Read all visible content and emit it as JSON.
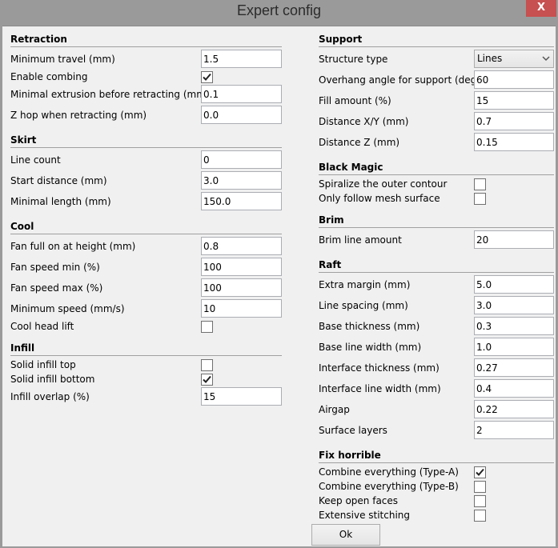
{
  "window": {
    "title": "Expert config",
    "close_label": "X"
  },
  "left": {
    "retraction": {
      "header": "Retraction",
      "minimum_travel": {
        "label": "Minimum travel (mm)",
        "value": "1.5"
      },
      "enable_combing": {
        "label": "Enable combing",
        "checked": true
      },
      "minimal_extrusion": {
        "label": "Minimal extrusion before retracting (mm)",
        "value": "0.1"
      },
      "z_hop": {
        "label": "Z hop when retracting (mm)",
        "value": "0.0"
      }
    },
    "skirt": {
      "header": "Skirt",
      "line_count": {
        "label": "Line count",
        "value": "0"
      },
      "start_distance": {
        "label": "Start distance (mm)",
        "value": "3.0"
      },
      "minimal_length": {
        "label": "Minimal length (mm)",
        "value": "150.0"
      }
    },
    "cool": {
      "header": "Cool",
      "fan_full_on": {
        "label": "Fan full on at height (mm)",
        "value": "0.8"
      },
      "fan_speed_min": {
        "label": "Fan speed min (%)",
        "value": "100"
      },
      "fan_speed_max": {
        "label": "Fan speed max (%)",
        "value": "100"
      },
      "minimum_speed": {
        "label": "Minimum speed (mm/s)",
        "value": "10"
      },
      "cool_head_lift": {
        "label": "Cool head lift",
        "checked": false
      }
    },
    "infill": {
      "header": "Infill",
      "solid_top": {
        "label": "Solid infill top",
        "checked": false
      },
      "solid_bottom": {
        "label": "Solid infill bottom",
        "checked": true
      },
      "overlap": {
        "label": "Infill overlap (%)",
        "value": "15"
      }
    }
  },
  "right": {
    "support": {
      "header": "Support",
      "structure_type": {
        "label": "Structure type",
        "value": "Lines"
      },
      "overhang_angle": {
        "label": "Overhang angle for support (deg)",
        "value": "60"
      },
      "fill_amount": {
        "label": "Fill amount (%)",
        "value": "15"
      },
      "distance_xy": {
        "label": "Distance X/Y (mm)",
        "value": "0.7"
      },
      "distance_z": {
        "label": "Distance Z (mm)",
        "value": "0.15"
      }
    },
    "black_magic": {
      "header": "Black Magic",
      "spiralize": {
        "label": "Spiralize the outer contour",
        "checked": false
      },
      "follow_surface": {
        "label": "Only follow mesh surface",
        "checked": false
      }
    },
    "brim": {
      "header": "Brim",
      "line_amount": {
        "label": "Brim line amount",
        "value": "20"
      }
    },
    "raft": {
      "header": "Raft",
      "extra_margin": {
        "label": "Extra margin (mm)",
        "value": "5.0"
      },
      "line_spacing": {
        "label": "Line spacing (mm)",
        "value": "3.0"
      },
      "base_thickness": {
        "label": "Base thickness (mm)",
        "value": "0.3"
      },
      "base_line_width": {
        "label": "Base line width (mm)",
        "value": "1.0"
      },
      "interface_thickness": {
        "label": "Interface thickness (mm)",
        "value": "0.27"
      },
      "interface_line_width": {
        "label": "Interface line width (mm)",
        "value": "0.4"
      },
      "airgap": {
        "label": "Airgap",
        "value": "0.22"
      },
      "surface_layers": {
        "label": "Surface layers",
        "value": "2"
      }
    },
    "fix_horrible": {
      "header": "Fix horrible",
      "combine_a": {
        "label": "Combine everything (Type-A)",
        "checked": true
      },
      "combine_b": {
        "label": "Combine everything (Type-B)",
        "checked": false
      },
      "keep_open_faces": {
        "label": "Keep open faces",
        "checked": false
      },
      "extensive_stitching": {
        "label": "Extensive stitching",
        "checked": false
      }
    }
  },
  "ok_label": "Ok",
  "colors": {
    "close_button": "#c75050",
    "titlebar": "#9a9a9a",
    "panel": "#f0f0f0"
  }
}
